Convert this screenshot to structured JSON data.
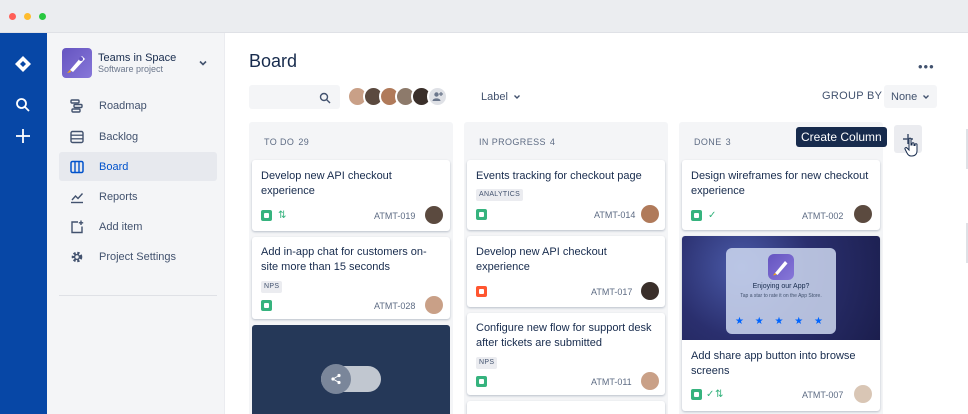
{
  "project": {
    "name": "Teams in Space",
    "type": "Software project"
  },
  "sidebar": {
    "items": [
      {
        "label": "Roadmap",
        "icon": "roadmap-icon"
      },
      {
        "label": "Backlog",
        "icon": "backlog-icon"
      },
      {
        "label": "Board",
        "icon": "board-icon",
        "active": true
      },
      {
        "label": "Reports",
        "icon": "reports-icon"
      },
      {
        "label": "Add item",
        "icon": "add-item-icon"
      },
      {
        "label": "Project Settings",
        "icon": "settings-icon"
      }
    ]
  },
  "board": {
    "title": "Board",
    "more": "•••",
    "label_filter": "Label",
    "group_by_label": "GROUP BY",
    "group_by_value": "None",
    "create_column_tooltip": "Create Column"
  },
  "columns": [
    {
      "title": "TO DO",
      "count": "29",
      "cards": [
        {
          "title": "Develop new API checkout experience",
          "key": "ATMT-019"
        },
        {
          "title": "Add in-app chat for customers on-site more than 15 seconds",
          "tag": "NPS",
          "key": "ATMT-028"
        }
      ]
    },
    {
      "title": "IN PROGRESS",
      "count": "4",
      "cards": [
        {
          "title": "Events tracking for checkout page",
          "tag": "ANALYTICS",
          "key": "ATMT-014"
        },
        {
          "title": "Develop new API checkout experience",
          "key": "ATMT-017"
        },
        {
          "title": "Configure new flow for support desk after tickets are submitted",
          "tag": "NPS",
          "key": "ATMT-011"
        }
      ]
    },
    {
      "title": "DONE",
      "count": "3",
      "cards": [
        {
          "title": "Design wireframes for new checkout experience",
          "key": "ATMT-002"
        },
        {
          "title": "Add share app button into browse screens",
          "key": "ATMT-007"
        }
      ]
    }
  ],
  "app_prompt": {
    "title": "Enjoying our App?",
    "subtitle": "Tap a star to rate it on the App Store.",
    "stars": "★ ★ ★ ★ ★"
  },
  "colors": {
    "global_nav": "#0747a6",
    "accent": "#0052cc",
    "story": "#36b37e",
    "bug": "#ff5630"
  }
}
